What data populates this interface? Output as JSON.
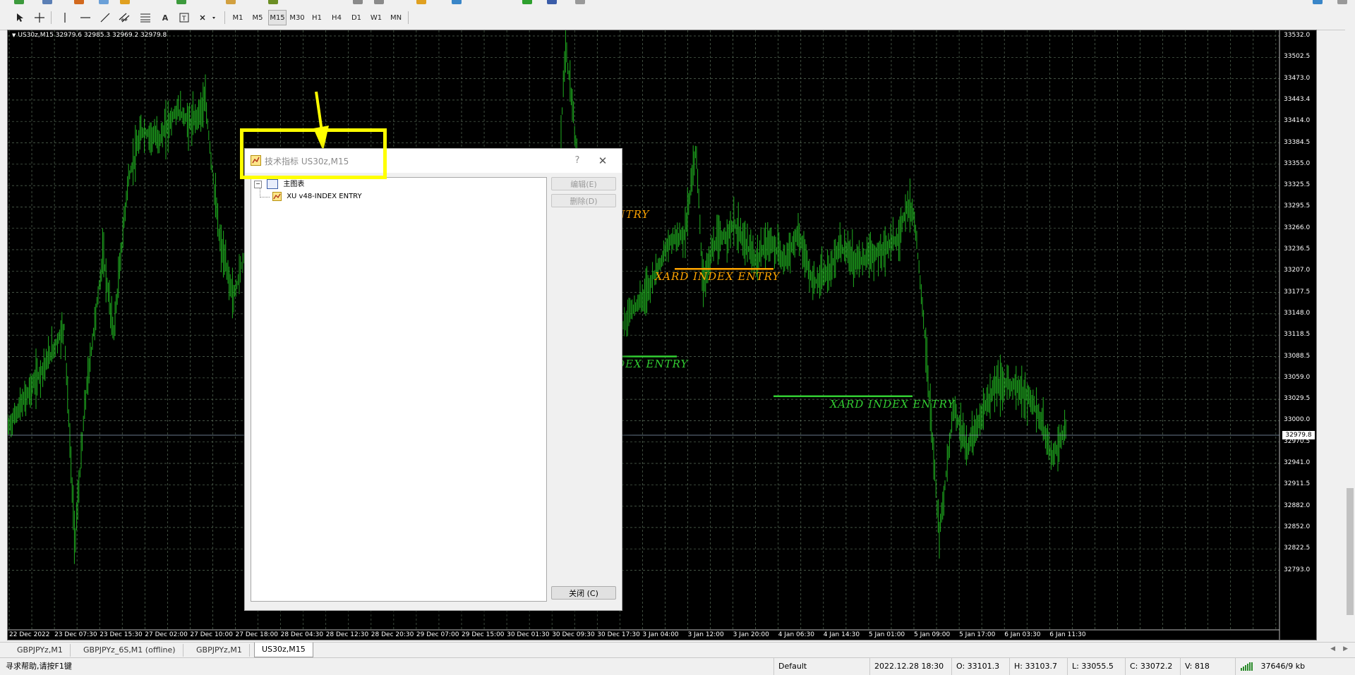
{
  "toolbar": {
    "timeframes": [
      "M1",
      "M5",
      "M15",
      "M30",
      "H1",
      "H4",
      "D1",
      "W1",
      "MN"
    ],
    "active_timeframe": "M15"
  },
  "chart": {
    "header": "US30z,M15  32979.6 32985.3 32969.2 32979.8",
    "current_price": "32979.8",
    "y_labels": [
      "33532.0",
      "33502.5",
      "33473.0",
      "33443.4",
      "33414.0",
      "33384.5",
      "33355.0",
      "33325.5",
      "33295.5",
      "33266.0",
      "33236.5",
      "33207.0",
      "33177.5",
      "33148.0",
      "33118.5",
      "33088.5",
      "33059.0",
      "33029.5",
      "33000.0",
      "32970.5",
      "32941.0",
      "32911.5",
      "32882.0",
      "32852.0",
      "32822.5",
      "32793.0"
    ],
    "x_labels": [
      "22 Dec 2022",
      "23 Dec 07:30",
      "23 Dec 15:30",
      "27 Dec 02:00",
      "27 Dec 10:00",
      "27 Dec 18:00",
      "28 Dec 04:30",
      "28 Dec 12:30",
      "28 Dec 20:30",
      "29 Dec 07:00",
      "29 Dec 15:00",
      "30 Dec 01:30",
      "30 Dec 09:30",
      "30 Dec 17:30",
      "3 Jan 04:00",
      "3 Jan 12:00",
      "3 Jan 20:00",
      "4 Jan 06:30",
      "4 Jan 14:30",
      "5 Jan 01:00",
      "5 Jan 09:00",
      "5 Jan 17:00",
      "6 Jan 03:30",
      "6 Jan 11:30"
    ],
    "entry_labels": [
      {
        "text": "XARD INDEX ENTRY",
        "color": "#ffa500",
        "price": 33286
      },
      {
        "text": "XARD INDEX ENTRY",
        "color": "#ffa500",
        "price": 33200
      },
      {
        "text": "XARD INDEX ENTRY",
        "color": "#32cd32",
        "price": 33079
      },
      {
        "text": "XARD INDEX ENTRY",
        "color": "#32cd32",
        "price": 33024
      }
    ],
    "colors": {
      "background": "#000000",
      "grid": "#5a6e5a",
      "candles": "#1fae1f"
    }
  },
  "dialog": {
    "title": "技术指标 US30z,M15",
    "help": "?",
    "tree_root": "主图表",
    "tree_item": "XU v48-INDEX ENTRY",
    "edit_button": "编辑(E)",
    "delete_button": "删除(D)",
    "close_button": "关闭 (C)"
  },
  "tabs": [
    "GBPJPYz,M1",
    "GBPJPYz_6S,M1 (offline)",
    "GBPJPYz,M1",
    "US30z,M15"
  ],
  "status": {
    "help": "寻求帮助,请按F1键",
    "profile": "Default",
    "datetime": "2022.12.28 18:30",
    "open": "O: 33101.3",
    "high": "H: 33103.7",
    "low": "L: 33055.5",
    "close": "C: 33072.2",
    "volume": "V: 818",
    "traffic": "37646/9 kb"
  }
}
